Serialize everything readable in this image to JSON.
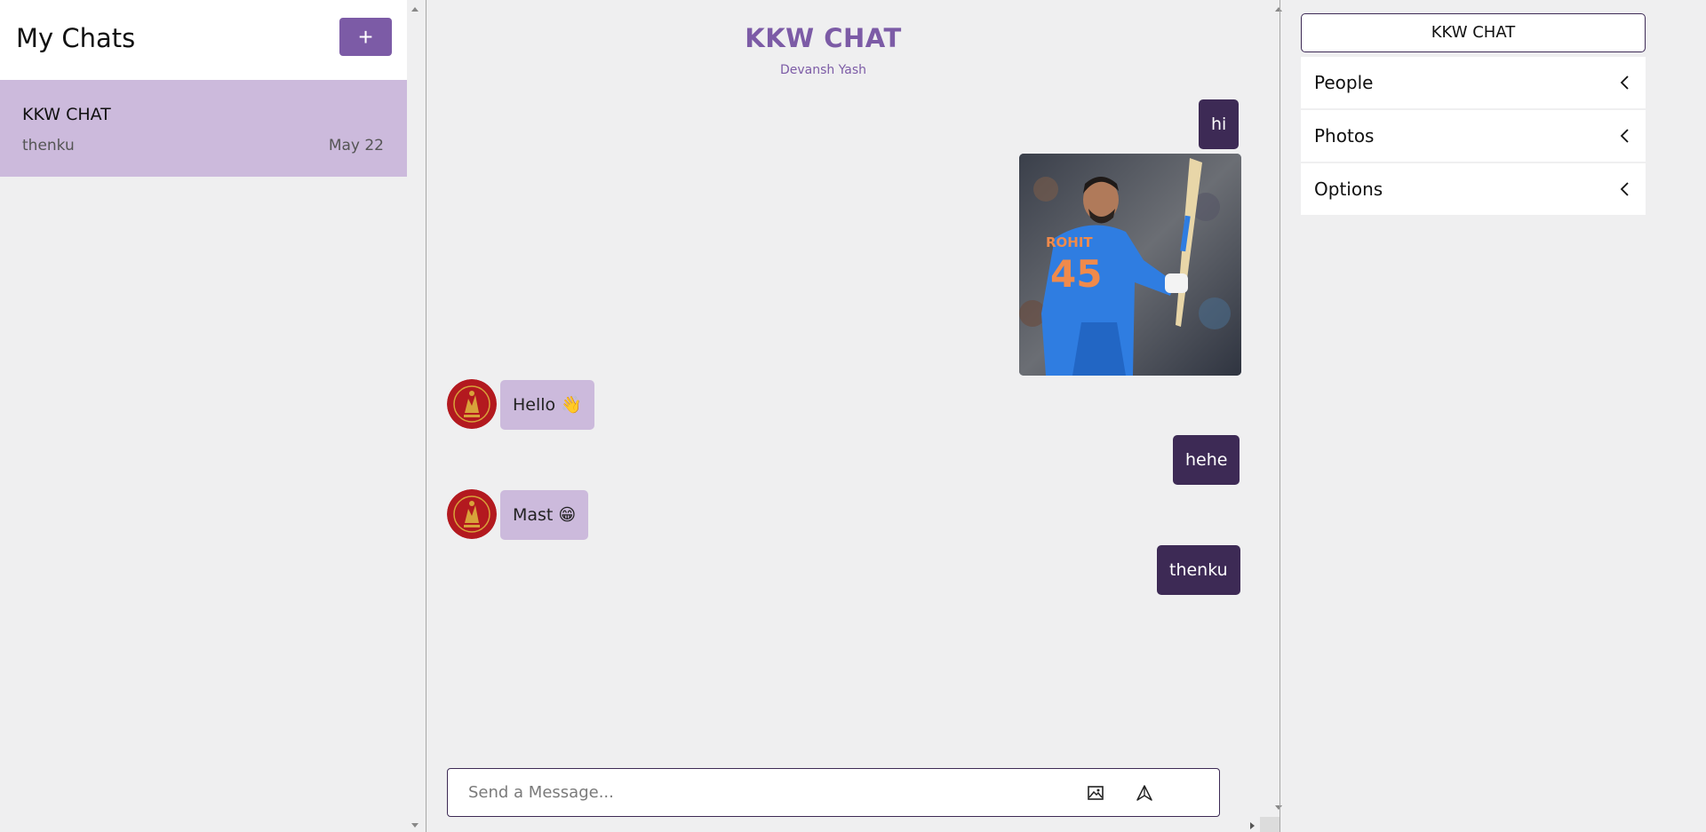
{
  "sidebar": {
    "title": "My Chats",
    "new_chat_label": "+",
    "chats": [
      {
        "name": "KKW CHAT",
        "last_message": "thenku",
        "date": "May 22"
      }
    ]
  },
  "chat": {
    "title": "KKW CHAT",
    "subtitle": "Devansh Yash",
    "messages": [
      {
        "direction": "out",
        "text": "hi"
      },
      {
        "direction": "out",
        "type": "image",
        "alt": "photo of cricketer in blue jersey number 45"
      },
      {
        "direction": "in",
        "text": "Hello 👋"
      },
      {
        "direction": "out",
        "text": "hehe"
      },
      {
        "direction": "in",
        "text": "Mast 😁"
      },
      {
        "direction": "out",
        "text": "thenku"
      }
    ],
    "composer": {
      "placeholder": "Send a Message...",
      "attach_icon": "image-icon",
      "send_icon": "send-icon"
    }
  },
  "settings": {
    "title": "KKW CHAT",
    "sections": [
      {
        "label": "People",
        "icon": "chevron-left-icon"
      },
      {
        "label": "Photos",
        "icon": "chevron-left-icon"
      },
      {
        "label": "Options",
        "icon": "chevron-left-icon"
      }
    ]
  },
  "theme": {
    "accent": "#7c5ba6",
    "outgoing_bubble": "#3d2a55",
    "incoming_bubble": "#ccbadc",
    "background": "#efeff0"
  }
}
